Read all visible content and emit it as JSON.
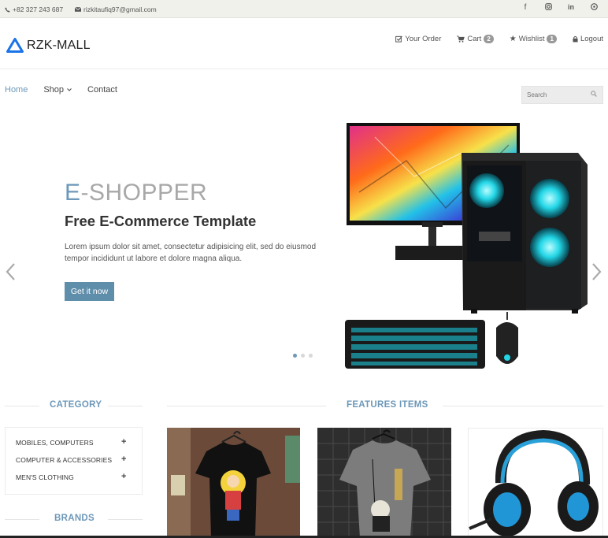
{
  "topbar": {
    "phone": "+82 327 243 687",
    "email": "rizkitaufiq97@gmail.com",
    "social": [
      "facebook-icon",
      "instagram-icon",
      "linkedin-icon",
      "github-icon"
    ]
  },
  "header": {
    "logo": "RZK-MALL",
    "menu": {
      "order": "Your Order",
      "cart": "Cart",
      "cart_count": "2",
      "wishlist": "Wishlist",
      "wishlist_count": "1",
      "logout": "Logout"
    }
  },
  "nav": {
    "home": "Home",
    "shop": "Shop",
    "contact": "Contact",
    "search_placeholder": "Search"
  },
  "hero": {
    "title_e": "E",
    "title_rest": "-SHOPPER",
    "subtitle": "Free E-Commerce Template",
    "description": "Lorem ipsum dolor sit amet, consectetur adipisicing elit, sed do eiusmod tempor incididunt ut labore et dolore magna aliqua.",
    "button": "Get it now",
    "slide_count": 3,
    "active_slide": 1
  },
  "sidebar": {
    "category_heading": "CATEGORY",
    "categories": [
      "MOBILES, COMPUTERS",
      "COMPUTER & ACCESSORIES",
      "MEN'S CLOTHING"
    ],
    "brands_heading": "BRANDS"
  },
  "features": {
    "heading": "FEATURES ITEMS"
  },
  "colors": {
    "accent": "#6d98b9",
    "button": "#5f8eab",
    "topbar_bg": "#f1f1ec"
  }
}
